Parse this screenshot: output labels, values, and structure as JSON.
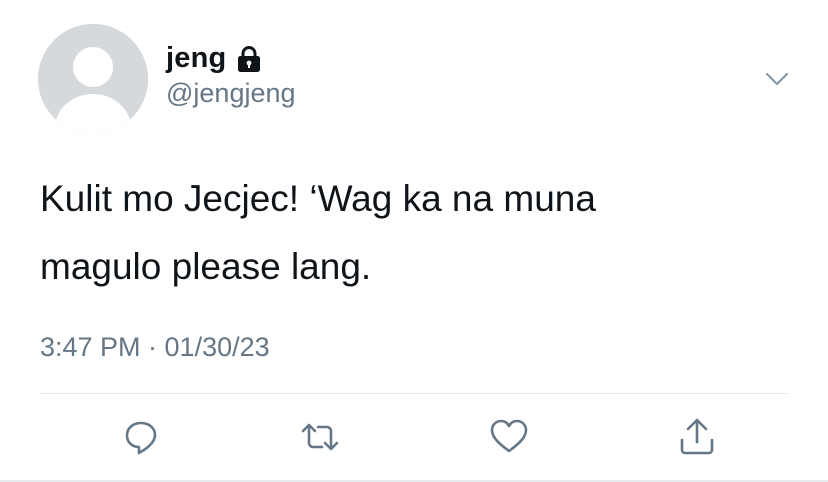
{
  "user": {
    "display_name": "jeng",
    "handle": "@jengjeng",
    "protected_icon": "lock-icon",
    "avatar": "default-avatar"
  },
  "tweet": {
    "lines": [
      "Kulit mo Jecjec! ‘Wag ka na muna",
      "magulo please lang."
    ],
    "timestamp": "3:47 PM · 01/30/23"
  },
  "actions": {
    "reply_icon": "reply-icon",
    "retweet_icon": "retweet-icon",
    "like_icon": "heart-icon",
    "share_icon": "share-icon",
    "menu_icon": "chevron-down-icon"
  },
  "colors": {
    "text": "#0f1419",
    "secondary": "#657786",
    "icon": "#657786",
    "avatar_bg": "#d6d9dc",
    "avatar_fg": "#ffffff",
    "divider": "#e1e8ed"
  }
}
